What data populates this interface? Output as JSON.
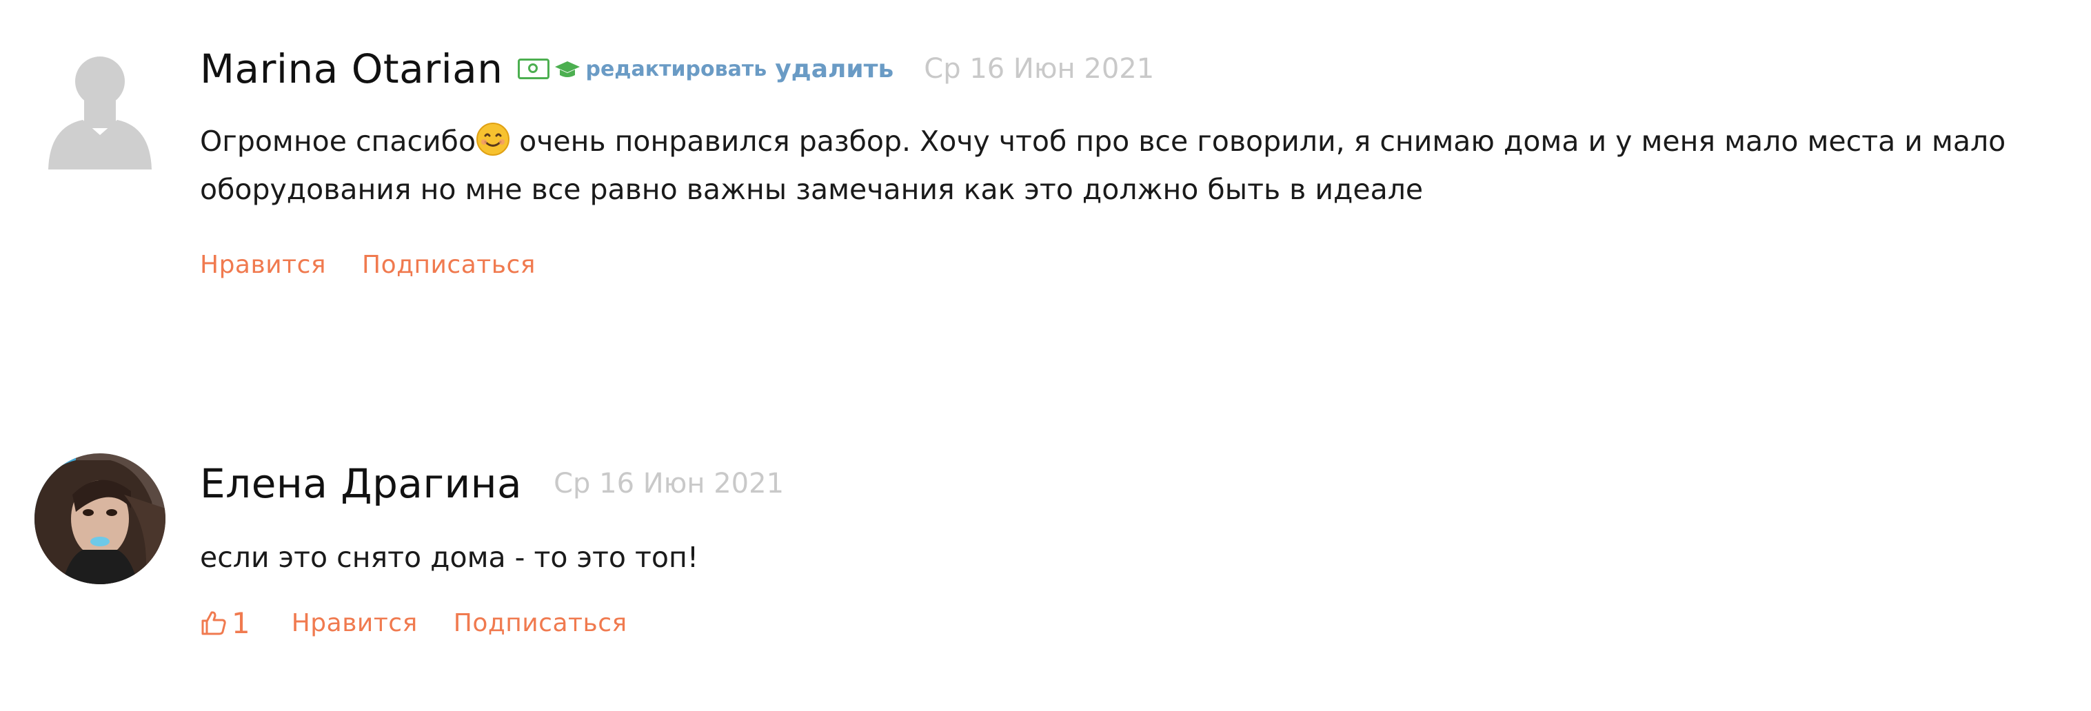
{
  "comments": [
    {
      "author": "Marina Otarian",
      "badges": [
        "money-badge-icon",
        "graduation-cap-icon"
      ],
      "edit_label": "редактировать",
      "delete_label": "удалить",
      "date": "Ср 16 Июн 2021",
      "text_before_emoji": "Огромное спасибо",
      "text_after_emoji": " очень понравился разбор. Хочу чтоб про все говорили, я снимаю дома и у меня мало места и мало оборудования но мне все равно важны замечания как это должно быть в идеале",
      "like_label": "Нравится",
      "subscribe_label": "Подписаться"
    },
    {
      "author": "Елена Драгина",
      "date": "Ср 16 Июн 2021",
      "text": "если это снято дома - то это топ!",
      "likes": "1",
      "like_label": "Нравится",
      "subscribe_label": "Подписаться"
    }
  ],
  "colors": {
    "action": "#f07a4f",
    "admin_link": "#6a9bc5",
    "date": "#c9c9c9",
    "badge_green": "#4caf50"
  }
}
